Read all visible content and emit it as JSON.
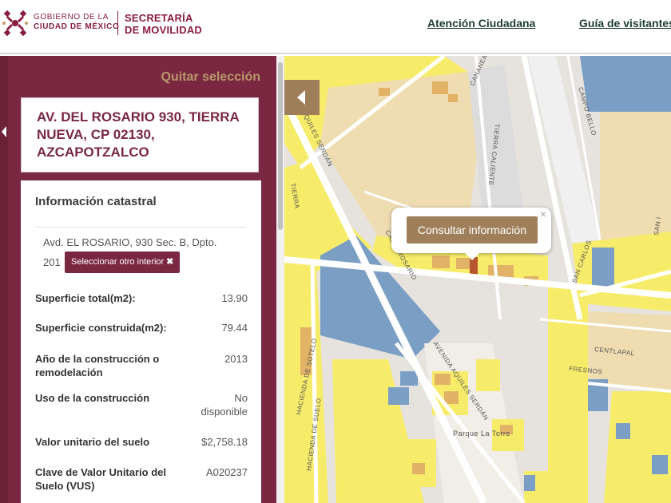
{
  "header": {
    "gob_line1": "GOBIERNO DE LA",
    "gob_line2": "CIUDAD DE MÉXICO",
    "sec_line1": "SECRETARÍA",
    "sec_line2": "DE MOVILIDAD",
    "nav": [
      "Atención Ciudadana",
      "Guía de visitantes"
    ]
  },
  "sidebar": {
    "quitar_label": "Quitar selección",
    "address": "AV. DEL ROSARIO 930, TIERRA NUEVA, CP 02130, AZCAPOTZALCO",
    "info_title": "Información catastral",
    "sub_line1": "Avd. EL ROSARIO, 930 Sec. B, Dpto.",
    "sub_num": "201",
    "select_button": "Seleccionar otro interior",
    "rows": [
      {
        "label": "Superficie total(m2):",
        "value": "13.90"
      },
      {
        "label": "Superficie construida(m2):",
        "value": "79.44"
      },
      {
        "label": "Año de la construcción o remodelación",
        "value": "2013"
      },
      {
        "label": "Uso de la construcción",
        "value": "No disponible"
      },
      {
        "label": "Valor unitario del suelo",
        "value": "$2,758.18"
      },
      {
        "label": "Clave de Valor Unitario del Suelo (VUS)",
        "value": "A020237"
      }
    ]
  },
  "map": {
    "popup_button": "Consultar información",
    "popup_close": "×",
    "street_labels": [
      "CAMPO BELLO",
      "AQUILES SERDÁN",
      "CANANEA",
      "TIERRA CALIENTE",
      "SAN CARLOS",
      "TIERRA",
      "CALLE ROSARIO",
      "HACIENDA DE SOTELO",
      "AVENIDA AQUILES SERDÁN",
      "CENTLAPAL",
      "FRESNOS",
      "HACIENDA DE SUELO",
      "SAN I"
    ],
    "park_label": "Parque La Torre"
  },
  "colors": {
    "brand": "#7a2842",
    "accent": "#9e7f5a",
    "parcel_yellow": "#f7ec6a",
    "parcel_blue": "#7b9ec4"
  }
}
